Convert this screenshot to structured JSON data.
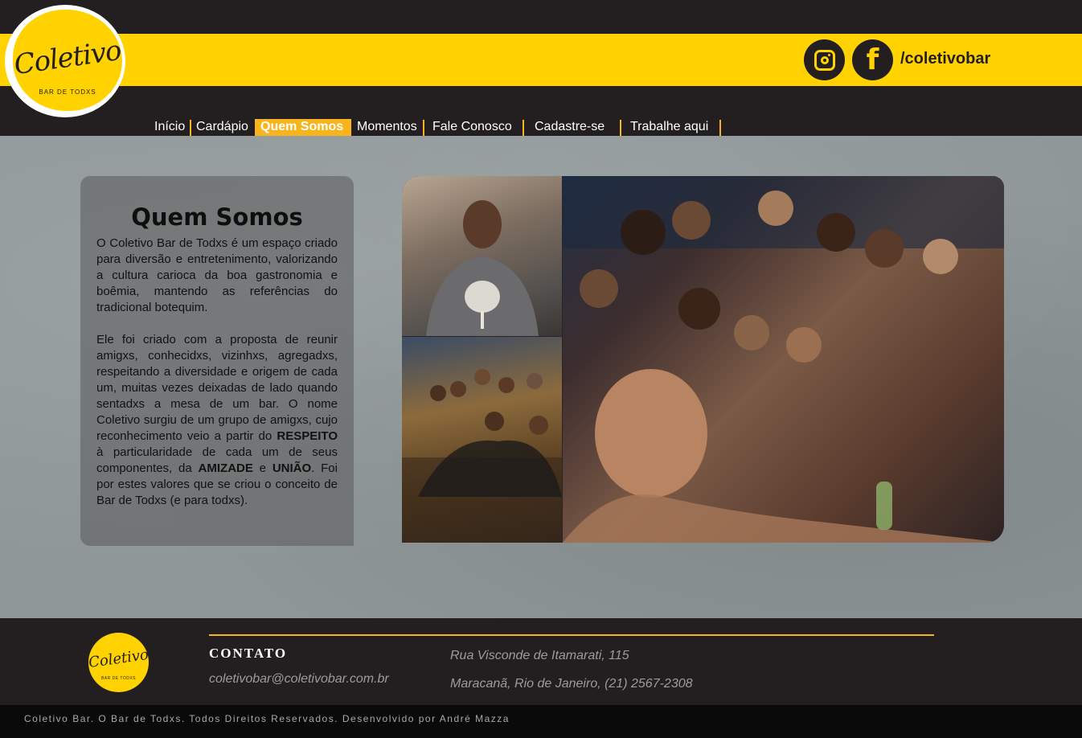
{
  "header": {
    "logo_script": "Coletivo",
    "logo_sub": "BAR DE TODXS",
    "social_handle": "/coletivobar",
    "brand_colors": {
      "yellow": "#ffd200",
      "dark": "#231f20",
      "accent": "#f7b41d"
    }
  },
  "nav": {
    "items": [
      {
        "label": "Início"
      },
      {
        "label": "Cardápio"
      },
      {
        "label": "Quem Somos",
        "active": true
      },
      {
        "label": "Momentos"
      },
      {
        "label": "Fale Conosco"
      },
      {
        "label": "Cadastre-se"
      },
      {
        "label": "Trabalhe aqui"
      }
    ]
  },
  "about": {
    "title": "Quem Somos",
    "paragraph1": "O Coletivo Bar de Todxs é um espaço criado para diversão e entretenimento, valorizando a cultura carioca da boa gastronomia e boêmia, mantendo as referências do tradicional botequim.",
    "paragraph2_a": "Ele foi criado com a proposta de reunir amigxs, conhecidxs, vizinhxs, agregadxs, respeitando a diversidade e origem de cada um, muitas vezes deixadas de lado quando sentadxs a mesa de um bar. O nome Coletivo surgiu de um grupo de amigxs, cujo reconhecimento veio a partir do ",
    "bold1": "RESPEITO",
    "paragraph2_b": " à particularidade de cada um de seus componentes, da ",
    "bold2": "AMIZADE",
    "paragraph2_c": " e ",
    "bold3": "UNIÃO",
    "paragraph2_d": ". Foi por estes valores que se criou o conceito de Bar de Todxs (e para todxs)."
  },
  "footer": {
    "logo_script": "Coletivo",
    "logo_sub": "BAR DE TODXS",
    "contact_title": "CONTATO",
    "email": "coletivobar@coletivobar.com.br",
    "address_line1": "Rua Visconde de Itamarati, 115",
    "address_line2": "Maracanã, Rio de Janeiro, (21) 2567-2308",
    "copyright": "Coletivo Bar. O Bar de Todxs. Todos Direitos Reservados. Desenvolvido por André Mazza"
  }
}
